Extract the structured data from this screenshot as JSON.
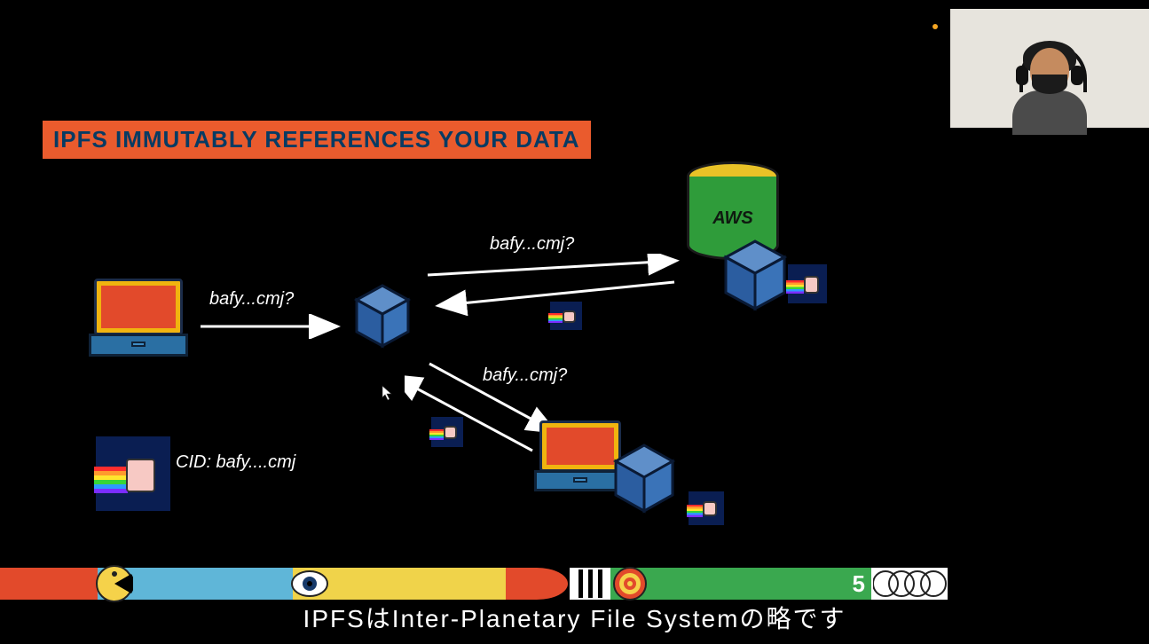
{
  "slide": {
    "title": "IPFS IMMUTABLY REFERENCES YOUR DATA",
    "page_number": "5",
    "subtitle": "IPFSはInter-Planetary File Systemの略です"
  },
  "labels": {
    "query1": "bafy...cmj?",
    "query2": "bafy...cmj?",
    "query3": "bafy...cmj?",
    "cid": "CID: bafy....cmj",
    "aws": "AWS"
  },
  "colors": {
    "banner_bg": "#ea5b2d",
    "banner_text": "#073b63",
    "laptop_frame": "#f0b40f",
    "laptop_screen": "#e24a2b",
    "laptop_base": "#2a6fa3",
    "cube_top": "#5f8fc9",
    "cube_left": "#2b5da0",
    "cube_right": "#3a73b8",
    "cylinder_top": "#e9c227",
    "cylinder_body": "#2f9c3a"
  }
}
